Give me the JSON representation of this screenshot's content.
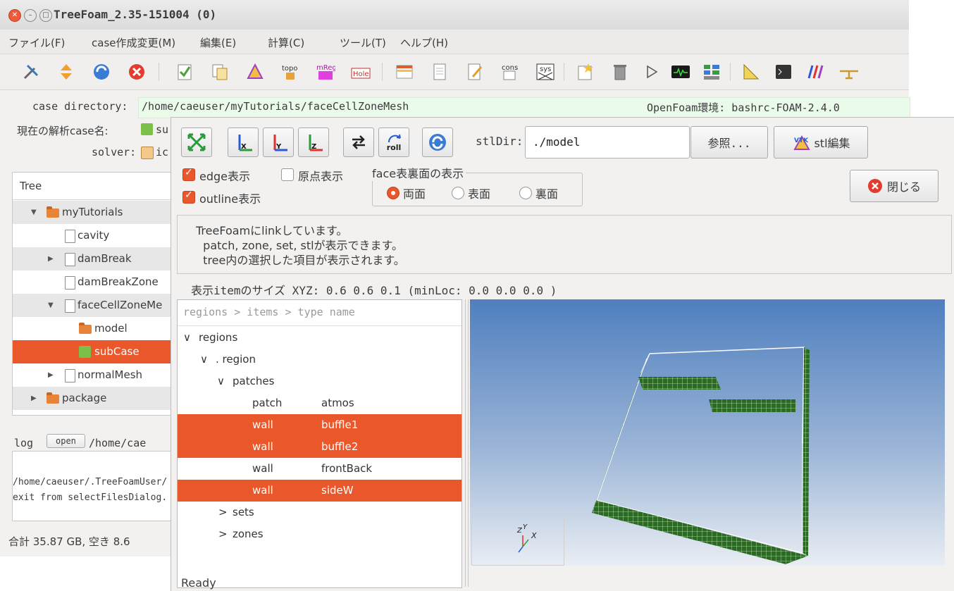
{
  "window": {
    "title": "TreeFoam_2.35-151004 (0)"
  },
  "menu": [
    "ファイル(F)",
    "case作成変更(M)",
    "編集(E)",
    "計算(C)",
    "ツール(T)",
    "ヘルプ(H)"
  ],
  "toolbar_icons": [
    "tools-icon",
    "sort-icon",
    "refresh-icon",
    "stop-icon",
    "check-doc-icon",
    "copy-doc-icon",
    "mesh-icon",
    "topo-icon",
    "mreg-icon",
    "hole-icon",
    "grid-icon",
    "doc-icon",
    "edit-doc-icon",
    "cons-icon",
    "sys-icon",
    "star-doc-icon",
    "trash-icon",
    "play-icon",
    "monitor-icon",
    "layout-icon",
    "ruler-icon",
    "terminal-icon",
    "bars-icon",
    "plane-icon"
  ],
  "info": {
    "case_directory_label": "case directory:",
    "case_directory_value": "/home/caeuser/myTutorials/faceCellZoneMesh",
    "openfoam_env": "OpenFoam環境: bashrc-FOAM-2.4.0",
    "current_case_label": "現在の解析case名:",
    "current_case_value": "su",
    "solver_label": "solver:",
    "solver_value": "ic"
  },
  "tree": {
    "header": "Tree",
    "items": [
      {
        "label": "myTutorials"
      },
      {
        "label": "cavity"
      },
      {
        "label": "damBreak"
      },
      {
        "label": "damBreakZone"
      },
      {
        "label": "faceCellZoneMe"
      },
      {
        "label": "model"
      },
      {
        "label": "subCase"
      },
      {
        "label": "normalMesh"
      },
      {
        "label": "package"
      }
    ]
  },
  "log": {
    "label": "log",
    "open_button": "open",
    "path": "/home/cae",
    "lines": [
      "/home/caeuser/.TreeFoamUser/",
      "exit from selectFilesDialog."
    ]
  },
  "footer_status": "合計 35.87 GB,  空き 8.6",
  "viewer": {
    "stldir_label": "stlDir:",
    "stldir_value": "./model",
    "browse_button": "参照...",
    "stl_edit_button": "stl編集",
    "roll_label": "roll",
    "edge_check": "edge表示",
    "origin_check": "原点表示",
    "outline_check": "outline表示",
    "face_group_label": "face表裏面の表示",
    "radio_both": "両面",
    "radio_front": "表面",
    "radio_back": "裏面",
    "close_button": "閉じる",
    "messages": [
      "TreeFoamにlinkしています。",
      "  patch, zone, set, stlが表示できます。",
      "  tree内の選択した項目が表示されます。"
    ],
    "size_info": "表示itemのサイズ XYZ: 0.6 0.6 0.1  (minLoc: 0.0 0.0 0.0 )",
    "breadcrumb": "regions > items > type name",
    "regions_tree": {
      "root": "regions",
      "region": ". region",
      "patches": "patches",
      "patch_rows": [
        {
          "type": "patch",
          "name": "atmos",
          "selected": false
        },
        {
          "type": "wall",
          "name": "buffle1",
          "selected": true
        },
        {
          "type": "wall",
          "name": "buffle2",
          "selected": true
        },
        {
          "type": "wall",
          "name": "frontBack",
          "selected": false
        },
        {
          "type": "wall",
          "name": "sideW",
          "selected": true
        }
      ],
      "sets": "sets",
      "zones": "zones"
    },
    "axes_labels": {
      "z": "Z",
      "y": "Y",
      "x": "X"
    },
    "status": "Ready"
  },
  "colors": {
    "accent": "#e9572b",
    "case_dir_bg": "#eafbea",
    "mesh_green": "#1f5a1a"
  }
}
